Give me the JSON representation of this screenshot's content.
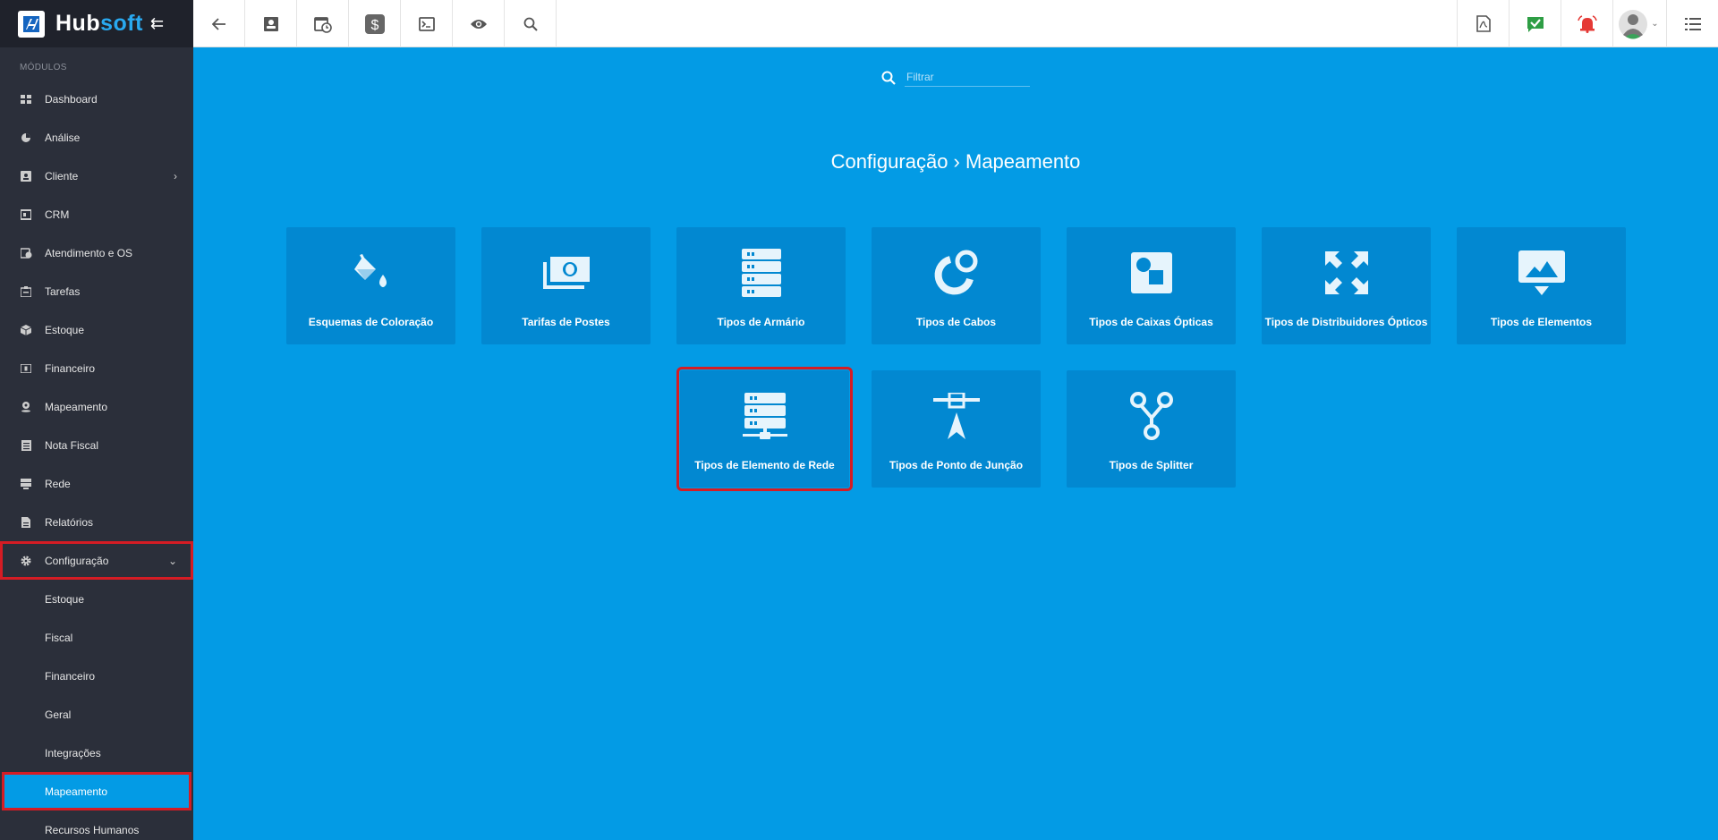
{
  "brand": {
    "name_a": "Hub",
    "name_b": "soft",
    "collapse_glyph": "⇇"
  },
  "sidebar": {
    "section": "MÓDULOS",
    "items": [
      {
        "label": "Dashboard",
        "icon": "dashboard-icon"
      },
      {
        "label": "Análise",
        "icon": "pie-chart-icon"
      },
      {
        "label": "Cliente",
        "icon": "contact-card-icon",
        "chevron": "›"
      },
      {
        "label": "CRM",
        "icon": "crm-icon"
      },
      {
        "label": "Atendimento e OS",
        "icon": "calendar-clock-icon"
      },
      {
        "label": "Tarefas",
        "icon": "tasks-icon"
      },
      {
        "label": "Estoque",
        "icon": "box-icon"
      },
      {
        "label": "Financeiro",
        "icon": "money-icon"
      },
      {
        "label": "Mapeamento",
        "icon": "map-pin-icon"
      },
      {
        "label": "Nota Fiscal",
        "icon": "invoice-icon"
      },
      {
        "label": "Rede",
        "icon": "network-icon"
      },
      {
        "label": "Relatórios",
        "icon": "report-icon"
      },
      {
        "label": "Configuração",
        "icon": "gear-icon",
        "chevron": "⌄"
      }
    ],
    "subitems": [
      "Estoque",
      "Fiscal",
      "Financeiro",
      "Geral",
      "Integrações",
      "Mapeamento",
      "Recursos Humanos"
    ]
  },
  "search": {
    "placeholder": "Filtrar"
  },
  "page": {
    "title": "Configuração › Mapeamento"
  },
  "cards": [
    {
      "label": "Esquemas de Coloração",
      "icon": "paint-bucket-icon"
    },
    {
      "label": "Tarifas de Postes",
      "icon": "money-stack-icon"
    },
    {
      "label": "Tipos de Armário",
      "icon": "server-rack-icon"
    },
    {
      "label": "Tipos de Cabos",
      "icon": "cable-ring-icon"
    },
    {
      "label": "Tipos de Caixas Ópticas",
      "icon": "optical-box-icon"
    },
    {
      "label": "Tipos de Distribuidores Ópticos",
      "icon": "expand-arrows-icon"
    },
    {
      "label": "Tipos de Elementos",
      "icon": "image-frame-icon"
    },
    {
      "label": "Tipos de Elemento de Rede",
      "icon": "network-server-icon"
    },
    {
      "label": "Tipos de Ponto de Junção",
      "icon": "junction-point-icon"
    },
    {
      "label": "Tipos de Splitter",
      "icon": "splitter-icon"
    }
  ]
}
